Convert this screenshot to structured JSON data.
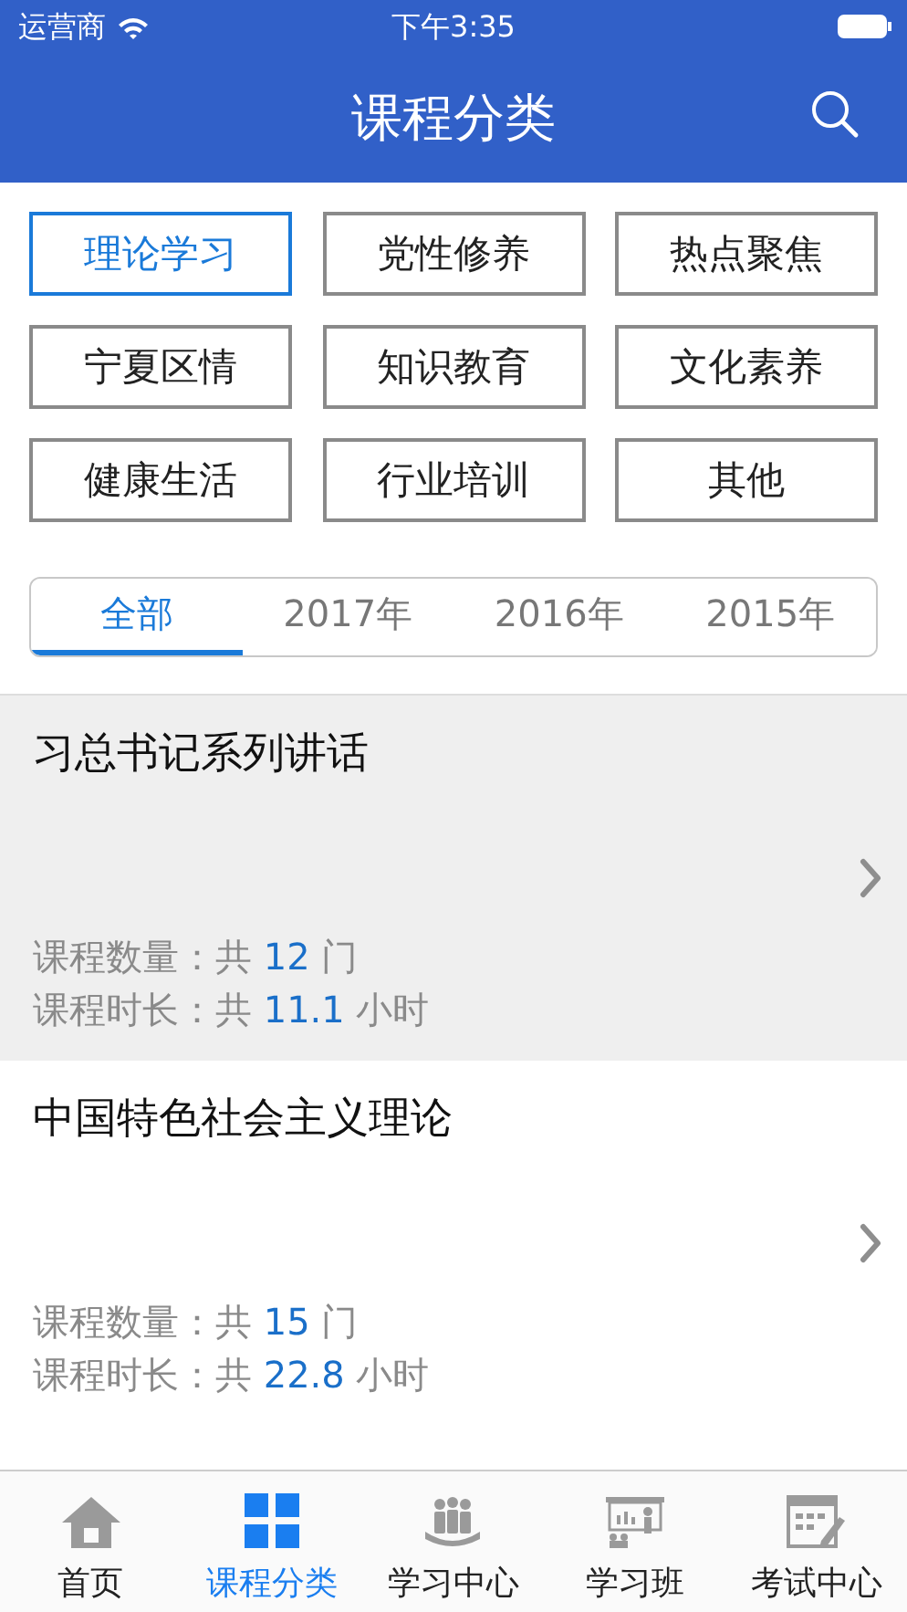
{
  "status_bar": {
    "carrier": "运营商",
    "time": "下午3:35"
  },
  "nav": {
    "title": "课程分类"
  },
  "categories": [
    {
      "label": "理论学习",
      "selected": true
    },
    {
      "label": "党性修养",
      "selected": false
    },
    {
      "label": "热点聚焦",
      "selected": false
    },
    {
      "label": "宁夏区情",
      "selected": false
    },
    {
      "label": "知识教育",
      "selected": false
    },
    {
      "label": "文化素养",
      "selected": false
    },
    {
      "label": "健康生活",
      "selected": false
    },
    {
      "label": "行业培训",
      "selected": false
    },
    {
      "label": "其他",
      "selected": false
    }
  ],
  "years": [
    {
      "label": "全部",
      "selected": true
    },
    {
      "label": "2017年",
      "selected": false
    },
    {
      "label": "2016年",
      "selected": false
    },
    {
      "label": "2015年",
      "selected": false
    }
  ],
  "courses": [
    {
      "title": "习总书记系列讲话",
      "selected": true,
      "count_label": "课程数量：共",
      "count": "12",
      "count_unit": "门",
      "duration_label": "课程时长：共",
      "duration": "11.1",
      "duration_unit": "小时"
    },
    {
      "title": "中国特色社会主义理论",
      "selected": false,
      "count_label": "课程数量：共",
      "count": "15",
      "count_unit": "门",
      "duration_label": "课程时长：共",
      "duration": "22.8",
      "duration_unit": "小时"
    }
  ],
  "tab_bar": [
    {
      "label": "首页",
      "kind": "home",
      "selected": false
    },
    {
      "label": "课程分类",
      "kind": "grid",
      "selected": true
    },
    {
      "label": "学习中心",
      "kind": "people",
      "selected": false
    },
    {
      "label": "学习班",
      "kind": "class",
      "selected": false
    },
    {
      "label": "考试中心",
      "kind": "exam",
      "selected": false
    }
  ]
}
